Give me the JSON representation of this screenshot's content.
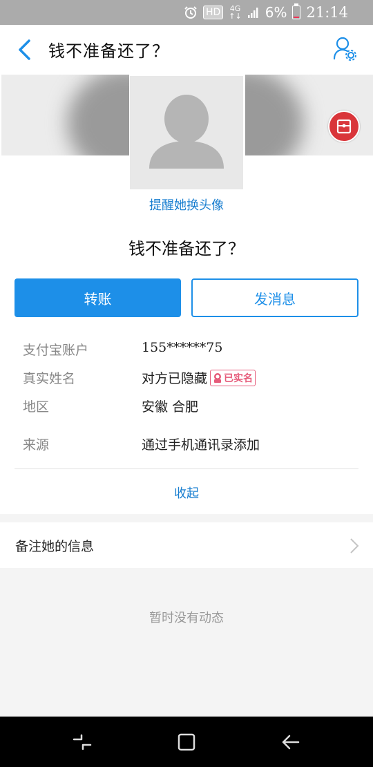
{
  "status_bar": {
    "hd": "HD",
    "network": "4G",
    "battery": "6%",
    "time": "21:14"
  },
  "header": {
    "title": "钱不准备还了？"
  },
  "cover": {
    "remind_link": "提醒她换头像"
  },
  "profile": {
    "name": "钱不准备还了？",
    "transfer_label": "转账",
    "message_label": "发消息",
    "fields": [
      {
        "label": "支付宝账户",
        "value": "155******75"
      },
      {
        "label": "真实姓名",
        "value": "对方已隐藏",
        "badge": "已实名"
      },
      {
        "label": "地区",
        "value": "安徽 合肥"
      },
      {
        "label": "来源",
        "value": "通过手机通讯录添加"
      }
    ],
    "collapse_label": "收起"
  },
  "remark": {
    "label": "备注她的信息"
  },
  "feed": {
    "empty_text": "暂时没有动态"
  },
  "colors": {
    "accent": "#1d8fe8",
    "link": "#1a7fd0",
    "verified": "#e65b7a",
    "badge_red": "#d9353a"
  },
  "icons": [
    "alarm-icon",
    "signal-icon",
    "battery-icon",
    "back-arrow-icon",
    "user-settings-icon",
    "gift-box-icon",
    "default-avatar-icon",
    "verified-icon",
    "chevron-right-icon",
    "recent-apps-icon",
    "home-icon",
    "back-icon"
  ]
}
